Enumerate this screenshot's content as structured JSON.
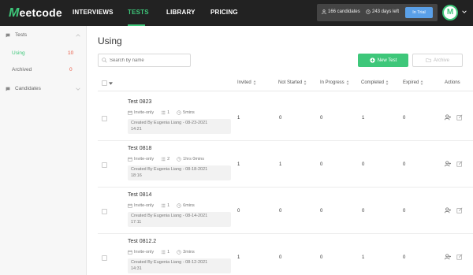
{
  "brand": {
    "logo_initial": "M",
    "logo_rest": "eetcode"
  },
  "nav": {
    "items": [
      "INTERVIEWS",
      "TESTS",
      "LIBRARY",
      "PRICING"
    ],
    "active": "TESTS"
  },
  "stats": {
    "candidates": "166 candidates",
    "days_left": "243 days left",
    "trial_button": "In Trial"
  },
  "user": {
    "avatar_initial": "M"
  },
  "sidebar": {
    "tests_label": "Tests",
    "using_label": "Using",
    "using_count": "10",
    "archived_label": "Archived",
    "archived_count": "0",
    "candidates_label": "Candidates"
  },
  "main": {
    "title": "Using",
    "search_placeholder": "Search by name",
    "new_test_label": "New Test",
    "archive_label": "Archive"
  },
  "table": {
    "columns": [
      "Invited",
      "Not Started",
      "In Progress",
      "Completed",
      "Expired",
      "Actions"
    ],
    "rows": [
      {
        "name": "Test 0823",
        "access": "Invite-only",
        "questions": "1",
        "duration": "5mins",
        "created_by": "Created By Eugenia Liang - 08-23-2021",
        "created_time": "14:21",
        "invited": "1",
        "not_started": "0",
        "in_progress": "0",
        "completed": "1",
        "expired": "0"
      },
      {
        "name": "Test 0818",
        "access": "Invite-only",
        "questions": "2",
        "duration": "1hrs 0mins",
        "created_by": "Created By Eugenia Liang - 08-18-2021",
        "created_time": "18:16",
        "invited": "1",
        "not_started": "1",
        "in_progress": "0",
        "completed": "0",
        "expired": "0"
      },
      {
        "name": "Test 0814",
        "access": "Invite-only",
        "questions": "1",
        "duration": "6mins",
        "created_by": "Created By Eugenia Liang - 08-14-2021",
        "created_time": "17:11",
        "invited": "0",
        "not_started": "0",
        "in_progress": "0",
        "completed": "0",
        "expired": "0"
      },
      {
        "name": "Test 0812.2",
        "access": "Invite-only",
        "questions": "1",
        "duration": "3mins",
        "created_by": "Created By Eugenia Liang - 08-12-2021",
        "created_time": "14:31",
        "invited": "1",
        "not_started": "0",
        "in_progress": "0",
        "completed": "1",
        "expired": "0"
      }
    ]
  },
  "colors": {
    "accent": "#3ec77a",
    "count_red": "#e8563f",
    "trial_blue": "#5aa0e8",
    "nav_bg": "#222222"
  }
}
